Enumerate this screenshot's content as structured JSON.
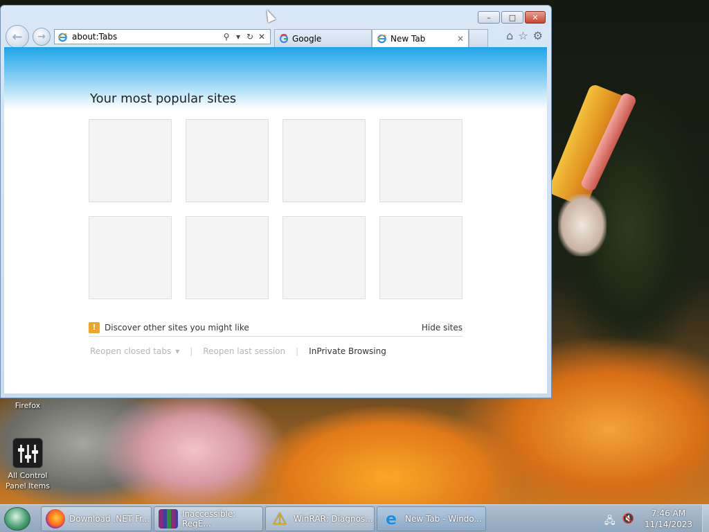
{
  "browser": {
    "address": "about:Tabs",
    "tabs": [
      {
        "label": "Google",
        "active": false
      },
      {
        "label": "New Tab",
        "active": true
      }
    ]
  },
  "content": {
    "title": "Your most popular sites",
    "tile_count": 8,
    "discover_label": "Discover other sites you might like",
    "hide_sites_label": "Hide sites",
    "reopen_closed_tabs": "Reopen closed tabs",
    "reopen_last_session": "Reopen last session",
    "inprivate_browsing": "InPrivate Browsing"
  },
  "desktop": {
    "icons": [
      {
        "label": "Firefox"
      },
      {
        "label": "All Control Panel Items"
      }
    ]
  },
  "taskbar": {
    "tasks": [
      {
        "label": "Download .NET Fr...",
        "icon": "firefox-icon"
      },
      {
        "label": "Inaccessible: RegE...",
        "icon": "winrar-icon"
      },
      {
        "label": "WinRAR: Diagnos...",
        "icon": "warning-icon"
      },
      {
        "label": "New Tab - Windo...",
        "icon": "internet-explorer-icon"
      }
    ],
    "clock_time": "7:46 AM",
    "clock_date": "11/14/2023"
  },
  "colors": {
    "accent": "#1fa5e9",
    "close": "#c8452e"
  }
}
